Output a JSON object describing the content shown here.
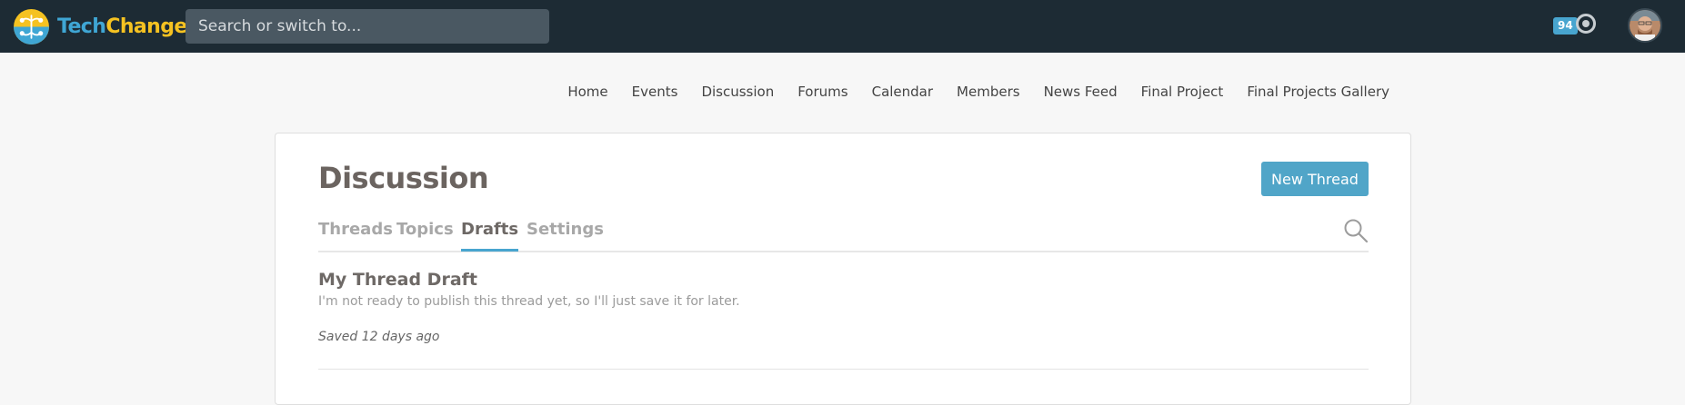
{
  "brand": {
    "logo_alt": "TechChange",
    "name_part1": "Tech",
    "name_part2": "Change",
    "colors": {
      "part1": "#3fa6d4",
      "part2": "#f5c221",
      "topbar": "#1d2b34"
    }
  },
  "search": {
    "placeholder": "Search or switch to..."
  },
  "notifications": {
    "count": "94"
  },
  "user": {
    "avatar_icon": "user-avatar-icon"
  },
  "nav": {
    "items": [
      {
        "label": "Home"
      },
      {
        "label": "Events"
      },
      {
        "label": "Discussion"
      },
      {
        "label": "Forums"
      },
      {
        "label": "Calendar"
      },
      {
        "label": "Members"
      },
      {
        "label": "News Feed"
      },
      {
        "label": "Final Project"
      },
      {
        "label": "Final Projects Gallery"
      }
    ]
  },
  "discussion": {
    "title": "Discussion",
    "new_thread_label": "New Thread",
    "accent": "#48a5cf",
    "tabs": [
      {
        "label": "Threads",
        "active": false
      },
      {
        "label": "Topics",
        "active": false
      },
      {
        "label": "Drafts",
        "active": true
      },
      {
        "label": "Settings",
        "active": false
      }
    ],
    "search_icon": "search-icon"
  },
  "drafts": [
    {
      "title": "My Thread Draft",
      "description": "I'm not ready to publish this thread yet, so I'll just save it for later.",
      "saved": "Saved 12 days ago"
    }
  ]
}
